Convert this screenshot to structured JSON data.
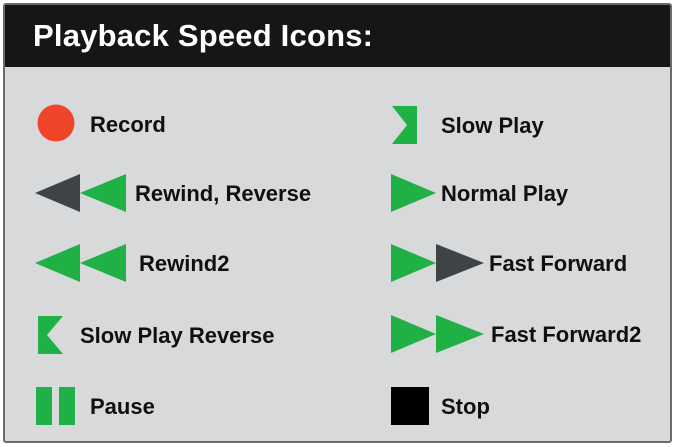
{
  "header": {
    "title": "Playback Speed Icons:"
  },
  "colors": {
    "green": "#1fb046",
    "dark_gray": "#3e4346",
    "red": "#f0452a",
    "black": "#000000",
    "panel_bg": "#d8d9db",
    "header_bg": "#161616"
  },
  "icons": {
    "left": [
      {
        "icon": "record-icon",
        "label": "Record"
      },
      {
        "icon": "rewind-reverse-icon",
        "label": "Rewind, Reverse"
      },
      {
        "icon": "rewind2-icon",
        "label": "Rewind2"
      },
      {
        "icon": "slow-play-reverse-icon",
        "label": "Slow Play Reverse"
      },
      {
        "icon": "pause-icon",
        "label": "Pause"
      }
    ],
    "right": [
      {
        "icon": "slow-play-icon",
        "label": "Slow Play"
      },
      {
        "icon": "normal-play-icon",
        "label": "Normal Play"
      },
      {
        "icon": "fast-forward-icon",
        "label": "Fast Forward"
      },
      {
        "icon": "fast-forward2-icon",
        "label": "Fast Forward2"
      },
      {
        "icon": "stop-icon",
        "label": "Stop"
      }
    ]
  }
}
